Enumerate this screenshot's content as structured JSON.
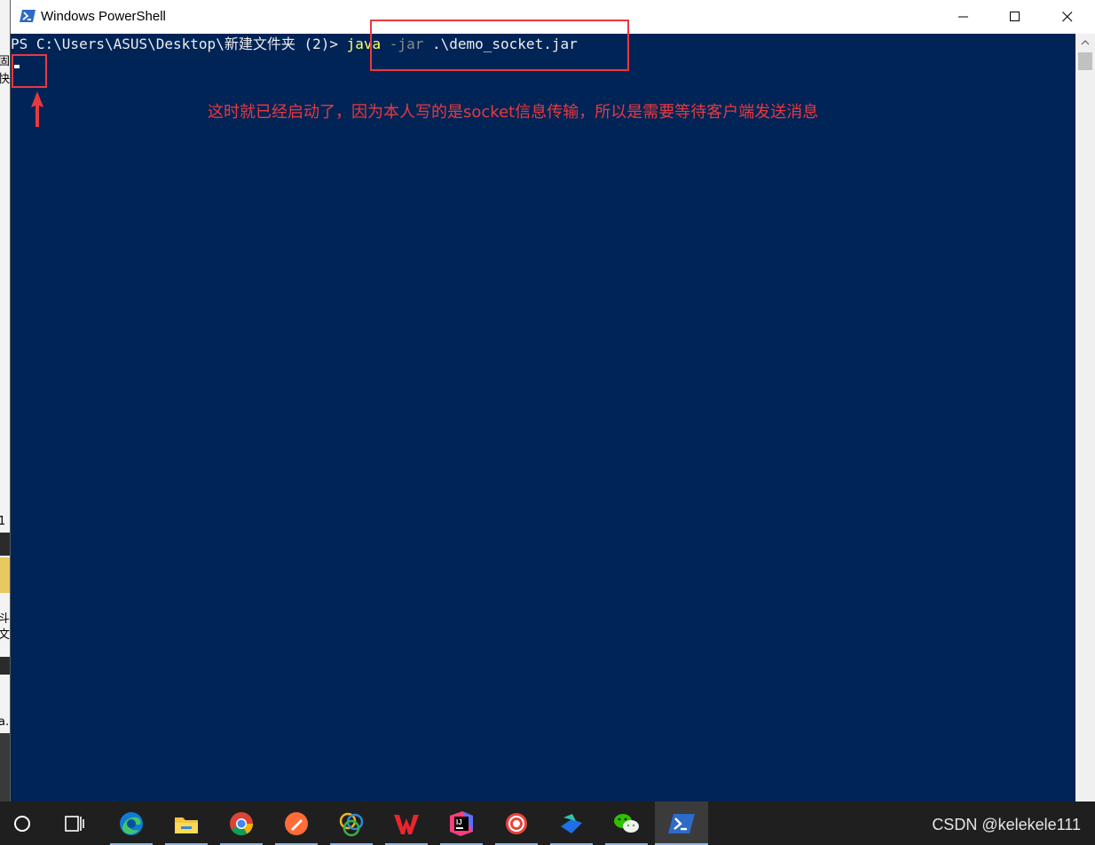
{
  "window": {
    "title": "Windows PowerShell",
    "icon": "powershell-icon",
    "controls": [
      "minimize-icon",
      "maximize-icon",
      "close-icon"
    ]
  },
  "terminal": {
    "prompt": "PS C:\\Users\\ASUS\\Desktop\\新建文件夹 (2)> ",
    "command": "java",
    "parameter": "-jar",
    "argument": ".\\demo_socket.jar",
    "colors": {
      "background": "#012456",
      "command": "#ffff66",
      "parameter": "#8a8a8a",
      "text": "#eeedf0"
    }
  },
  "annotation": {
    "text": "这时就已经启动了，因为本人写的是socket信息传输，所以是需要等待客户端发送消息",
    "color": "#e8393f"
  },
  "desktop_fragments": [
    "固",
    "快通",
    "1",
    "斗",
    "文",
    "a."
  ],
  "taskbar": {
    "items": [
      {
        "name": "start-icon"
      },
      {
        "name": "task-view-icon"
      },
      {
        "name": "edge-icon"
      },
      {
        "name": "file-explorer-icon"
      },
      {
        "name": "chrome-icon"
      },
      {
        "name": "postman-icon"
      },
      {
        "name": "navicat-icon"
      },
      {
        "name": "wps-icon"
      },
      {
        "name": "intellij-idea-icon"
      },
      {
        "name": "snail-app-icon"
      },
      {
        "name": "feishu-icon"
      },
      {
        "name": "wechat-icon"
      },
      {
        "name": "powershell-taskbar-icon"
      }
    ],
    "watermark": "CSDN @kelekele111"
  }
}
